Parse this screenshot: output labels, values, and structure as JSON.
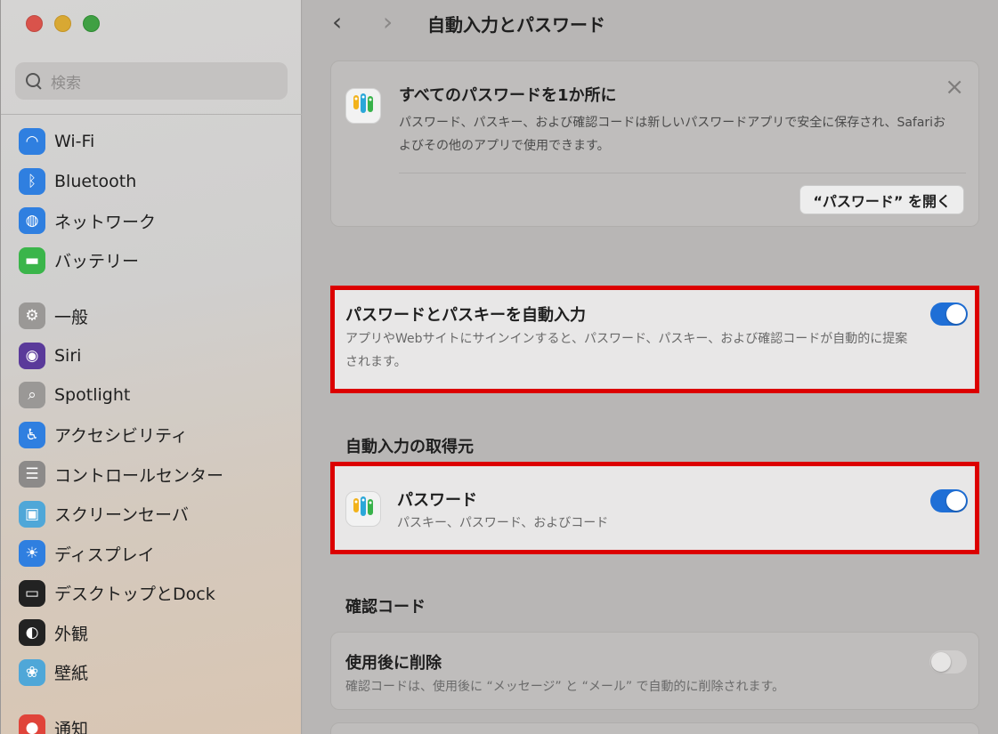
{
  "window": {
    "title": "自動入力とパスワード"
  },
  "sidebar": {
    "search_placeholder": "検索",
    "items": [
      {
        "label": "Wi-Fi",
        "icon": "wifi-icon",
        "color": "#2f7fe0",
        "glyph": "◠"
      },
      {
        "label": "Bluetooth",
        "icon": "bluetooth-icon",
        "color": "#2f7fe0",
        "glyph": "ᛒ"
      },
      {
        "label": "ネットワーク",
        "icon": "globe-icon",
        "color": "#2f7fe0",
        "glyph": "◍"
      },
      {
        "label": "バッテリー",
        "icon": "battery-icon",
        "color": "#3ab54a",
        "glyph": "▬"
      },
      {
        "label": "一般",
        "icon": "gear-icon",
        "color": "#9a9896",
        "glyph": "⚙"
      },
      {
        "label": "Siri",
        "icon": "siri-icon",
        "color": "#5a3a9a",
        "glyph": "◉"
      },
      {
        "label": "Spotlight",
        "icon": "spotlight-icon",
        "color": "#9a9896",
        "glyph": "⌕"
      },
      {
        "label": "アクセシビリティ",
        "icon": "accessibility-icon",
        "color": "#2f7fe0",
        "glyph": "♿"
      },
      {
        "label": "コントロールセンター",
        "icon": "control-center-icon",
        "color": "#8c8a89",
        "glyph": "☰"
      },
      {
        "label": "スクリーンセーバ",
        "icon": "screensaver-icon",
        "color": "#4fa7d8",
        "glyph": "▣"
      },
      {
        "label": "ディスプレイ",
        "icon": "display-icon",
        "color": "#2f7fe0",
        "glyph": "☀"
      },
      {
        "label": "デスクトップとDock",
        "icon": "dock-icon",
        "color": "#222222",
        "glyph": "▭"
      },
      {
        "label": "外観",
        "icon": "appearance-icon",
        "color": "#222222",
        "glyph": "◐"
      },
      {
        "label": "壁紙",
        "icon": "wallpaper-icon",
        "color": "#4fa7d8",
        "glyph": "❀"
      },
      {
        "label": "通知",
        "icon": "notifications-icon",
        "color": "#e0443a",
        "glyph": "●"
      }
    ]
  },
  "banner": {
    "title": "すべてのパスワードを1か所に",
    "description": "パスワード、パスキー、および確認コードは新しいパスワードアプリで安全に保存され、Safariおよびその他のアプリで使用できます。",
    "button": "“パスワード” を開く"
  },
  "autofill": {
    "title": "パスワードとパスキーを自動入力",
    "description": "アプリやWebサイトにサインインすると、パスワード、パスキー、および確認コードが自動的に提案されます。",
    "enabled": true
  },
  "sources": {
    "heading": "自動入力の取得元",
    "item_title": "パスワード",
    "item_subtitle": "パスキー、パスワード、およびコード",
    "enabled": true
  },
  "codes": {
    "heading": "確認コード",
    "title": "使用後に削除",
    "description": "確認コードは、使用後に “メッセージ” と “メール” で自動的に削除されます。",
    "enabled": false
  },
  "colors": {
    "accent": "#1f6fd6",
    "highlight": "#dc0000"
  }
}
